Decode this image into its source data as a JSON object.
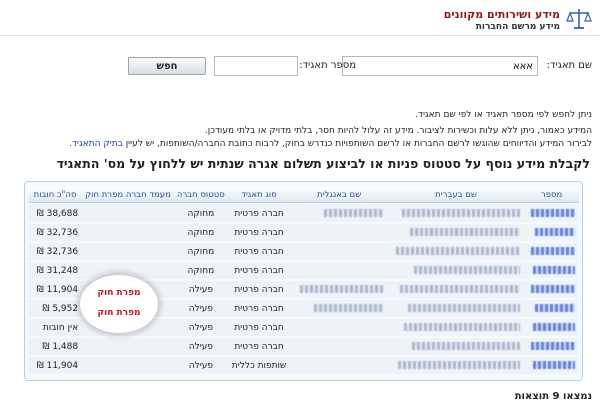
{
  "header": {
    "title": "מידע ושירותים מקוונים",
    "subtitle": "מידע מרשם החברות",
    "logo_icon": "scales-icon"
  },
  "search": {
    "name_label": "שם תאגיד:",
    "name_value": "אאא",
    "number_label": "מספר תאגיד:",
    "number_value": "",
    "button_label": "חפש"
  },
  "info": {
    "line1": "ניתן לחפש לפי מספר תאגיד או לפי שם תאגיד.",
    "line2": "המידע כאמור, ניתן ללא עלות וכשירות לציבור. מידע זה עלול להיות חסר, בלתי מדויק או בלתי מעודכן.",
    "line3": "לבירור המידע והדיווחים שהוגשו לרשם החברות או לרשם השותפויות כנדרש בחוק, לרבות כתובת החברה/השותפות, יש לעיין ",
    "link": "בתיק התאגיד."
  },
  "section_title": "לקבלת מידע נוסף על סטטוס פניות או לביצוע תשלום אגרה שנתית יש ללחוץ על מס' התאגיד",
  "table": {
    "headers": [
      "מספר",
      "שם בעברית",
      "שם באנגלית",
      "סוג תאגיד",
      "סטטוס חברה",
      "מעמד חברה מפרת חוק",
      "סה\"כ חובות"
    ],
    "rows": [
      {
        "type": "חברה פרטית",
        "status": "מחוקה",
        "violator": "",
        "debt": "38,688 ₪"
      },
      {
        "type": "חברה פרטית",
        "status": "מחוקה",
        "violator": "",
        "debt": "32,736 ₪"
      },
      {
        "type": "חברה פרטית",
        "status": "מחוקה",
        "violator": "",
        "debt": "32,736 ₪"
      },
      {
        "type": "חברה פרטית",
        "status": "מחוקה",
        "violator": "",
        "debt": "31,248 ₪"
      },
      {
        "type": "חברה פרטית",
        "status": "פעילה",
        "violator": "מפרת חוק",
        "debt": "11,904 ₪"
      },
      {
        "type": "חברה פרטית",
        "status": "פעילה",
        "violator": "מפרת חוק",
        "debt": "5,952 ₪"
      },
      {
        "type": "חברה פרטית",
        "status": "פעילה",
        "violator": "",
        "debt": "אין חובות"
      },
      {
        "type": "חברה פרטית",
        "status": "פעילה",
        "violator": "",
        "debt": "1,488 ₪"
      },
      {
        "type": "שותפות כללית",
        "status": "פעילה",
        "violator": "",
        "debt": "11,904 ₪"
      }
    ]
  },
  "results": "נמצאו 9 תוצאות",
  "colors": {
    "title_red": "#8b1a1a",
    "violator_red": "#c4161c",
    "link_blue": "#1d3f9a",
    "table_border": "#b9cfe3"
  }
}
